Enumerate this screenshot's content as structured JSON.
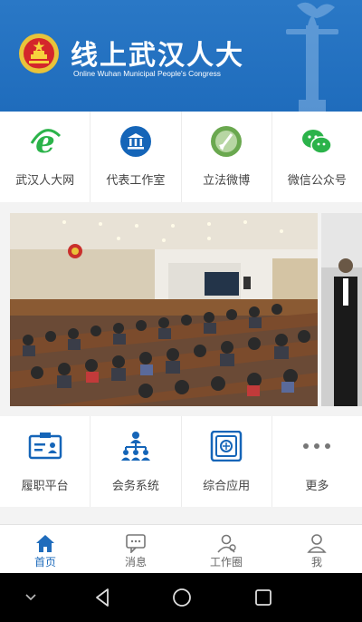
{
  "colors": {
    "brand": "#1f6cbc",
    "accent_green": "#2bb34a",
    "icon_blue": "#1565b8"
  },
  "header": {
    "title": "线上武汉人大",
    "subtitle": "Online Wuhan Municipal People's Congress"
  },
  "quick_links": [
    {
      "label": "武汉人大网",
      "icon": "ie-browser-icon"
    },
    {
      "label": "代表工作室",
      "icon": "bank-building-icon"
    },
    {
      "label": "立法微博",
      "icon": "weibo-icon"
    },
    {
      "label": "微信公众号",
      "icon": "wechat-icon"
    }
  ],
  "banner": {
    "description": "meeting-room-photo"
  },
  "apps": [
    {
      "label": "履职平台",
      "icon": "id-card-icon"
    },
    {
      "label": "会务系统",
      "icon": "org-chart-icon"
    },
    {
      "label": "综合应用",
      "icon": "app-frame-icon"
    },
    {
      "label": "更多",
      "icon": "more-dots-icon"
    }
  ],
  "tabs": [
    {
      "label": "首页",
      "icon": "home-icon",
      "active": true
    },
    {
      "label": "消息",
      "icon": "message-icon",
      "active": false
    },
    {
      "label": "工作圈",
      "icon": "group-icon",
      "active": false
    },
    {
      "label": "我",
      "icon": "person-icon",
      "active": false
    }
  ],
  "system_nav": [
    "chevron-down-icon",
    "back-icon",
    "home-circle-icon",
    "recents-icon"
  ]
}
